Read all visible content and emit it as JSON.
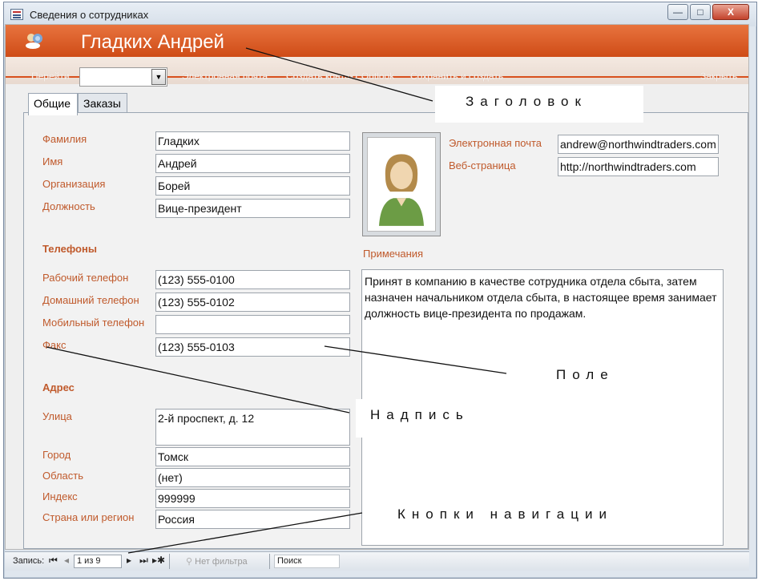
{
  "window": {
    "title": "Сведения о сотрудниках",
    "controls": {
      "minimize": "—",
      "maximize": "□",
      "close": "X"
    }
  },
  "header": {
    "title": "Гладких Андрей"
  },
  "toolbar": {
    "goto_label": "Перейти",
    "email_label": "Электронная почта",
    "outlook_label": "Создать контакт Outlook",
    "save_new_label": "Сохранить и создать",
    "close_label": "Закрыть"
  },
  "tabs": [
    {
      "label": "Общие",
      "active": true
    },
    {
      "label": "Заказы",
      "active": false
    }
  ],
  "fields": {
    "last_name": {
      "label": "Фамилия",
      "value": "Гладких"
    },
    "first_name": {
      "label": "Имя",
      "value": "Андрей"
    },
    "company": {
      "label": "Организация",
      "value": "Борей"
    },
    "job_title": {
      "label": "Должность",
      "value": "Вице-президент"
    },
    "work_phone": {
      "label": "Рабочий телефон",
      "value": "(123) 555-0100"
    },
    "home_phone": {
      "label": "Домашний телефон",
      "value": "(123) 555-0102"
    },
    "mobile_phone": {
      "label": "Мобильный телефон",
      "value": ""
    },
    "fax": {
      "label": "Факс",
      "value": "(123) 555-0103"
    },
    "street": {
      "label": "Улица",
      "value": "2-й проспект, д. 12"
    },
    "city": {
      "label": "Город",
      "value": "Томск"
    },
    "region": {
      "label": "Область",
      "value": "(нет)"
    },
    "zip": {
      "label": "Индекс",
      "value": "999999"
    },
    "country": {
      "label": "Страна или регион",
      "value": "Россия"
    },
    "email": {
      "label": "Электронная почта",
      "value": "andrew@northwindtraders.com"
    },
    "web": {
      "label": "Веб-страница",
      "value": "http://northwindtraders.com"
    }
  },
  "sections": {
    "phones": "Телефоны",
    "address": "Адрес"
  },
  "notes": {
    "label": "Примечания",
    "text": "Принят в компанию в качестве сотрудника отдела сбыта, затем назначен начальником отдела сбыта, в настоящее время занимает должность вице-президента по продажам."
  },
  "statusbar": {
    "record_label": "Запись:",
    "record_position": "1 из 9",
    "filter_label": "Нет фильтра",
    "search_placeholder": "Поиск",
    "first": "⏮",
    "prev": "◂",
    "next": "▸",
    "last": "⏭",
    "new": "▸✱"
  },
  "callouts": {
    "title": "Заголовок",
    "field": "Поле",
    "label": "Надпись",
    "nav": "Кнопки навигации"
  },
  "colors": {
    "header_orange": "#d85a22",
    "label_orange": "#c05a2c",
    "window_frame": "#7a8aa0"
  },
  "icons": {
    "app": "form-icon",
    "header": "people-icon",
    "photo": "person-photo-icon",
    "dropdown": "chevron-down-icon"
  }
}
